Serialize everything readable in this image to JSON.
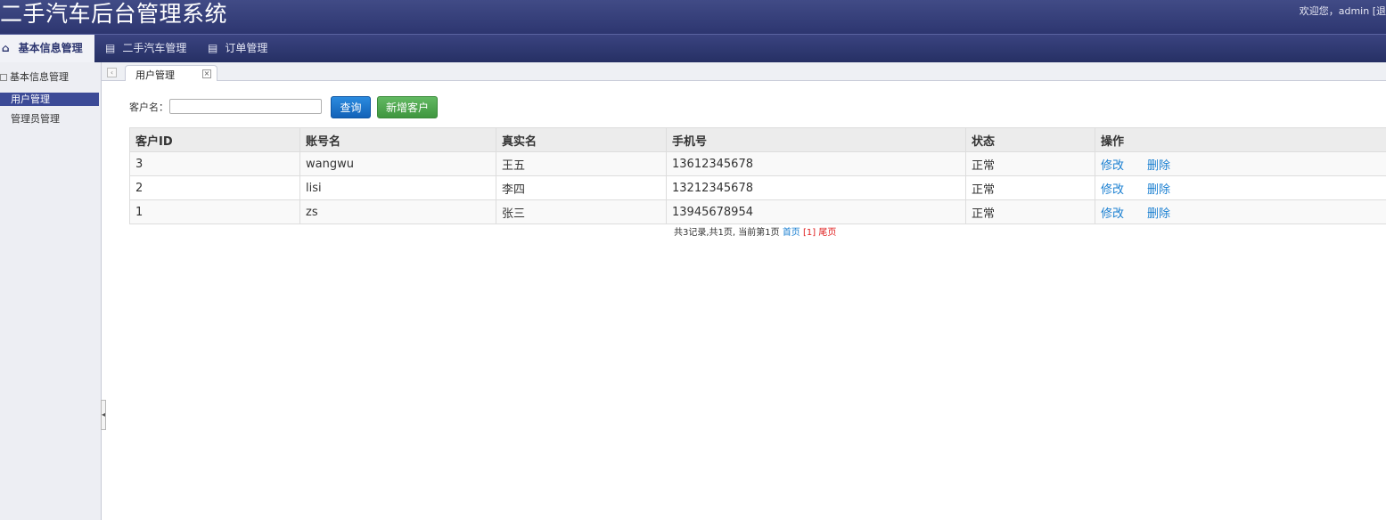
{
  "header": {
    "title": "二手汽车后台管理系统",
    "welcome": "欢迎您，admin [退"
  },
  "nav": {
    "tabs": [
      {
        "label": "基本信息管理",
        "icon": "home-icon"
      },
      {
        "label": "二手汽车管理",
        "icon": "list-icon"
      },
      {
        "label": "订单管理",
        "icon": "list-icon"
      }
    ]
  },
  "sidebar": {
    "group": "基本信息管理",
    "items": [
      {
        "label": "用户管理"
      },
      {
        "label": "管理员管理"
      }
    ]
  },
  "tab": {
    "label": "用户管理"
  },
  "search": {
    "label": "客户名：",
    "value": "",
    "query_label": "查询",
    "add_label": "新增客户"
  },
  "table": {
    "headers": [
      "客户ID",
      "账号名",
      "真实名",
      "手机号",
      "状态",
      "操作"
    ],
    "rows": [
      {
        "id": "3",
        "account": "wangwu",
        "real_name": "王五",
        "phone": "13612345678",
        "status": "正常",
        "edit": "修改",
        "delete": "删除"
      },
      {
        "id": "2",
        "account": "lisi",
        "real_name": "李四",
        "phone": "13212345678",
        "status": "正常",
        "edit": "修改",
        "delete": "删除"
      },
      {
        "id": "1",
        "account": "zs",
        "real_name": "张三",
        "phone": "13945678954",
        "status": "正常",
        "edit": "修改",
        "delete": "删除"
      }
    ]
  },
  "pager": {
    "summary": "共3记录,共1页, 当前第1页",
    "first": "首页",
    "current": "[1]",
    "last": "尾页"
  }
}
